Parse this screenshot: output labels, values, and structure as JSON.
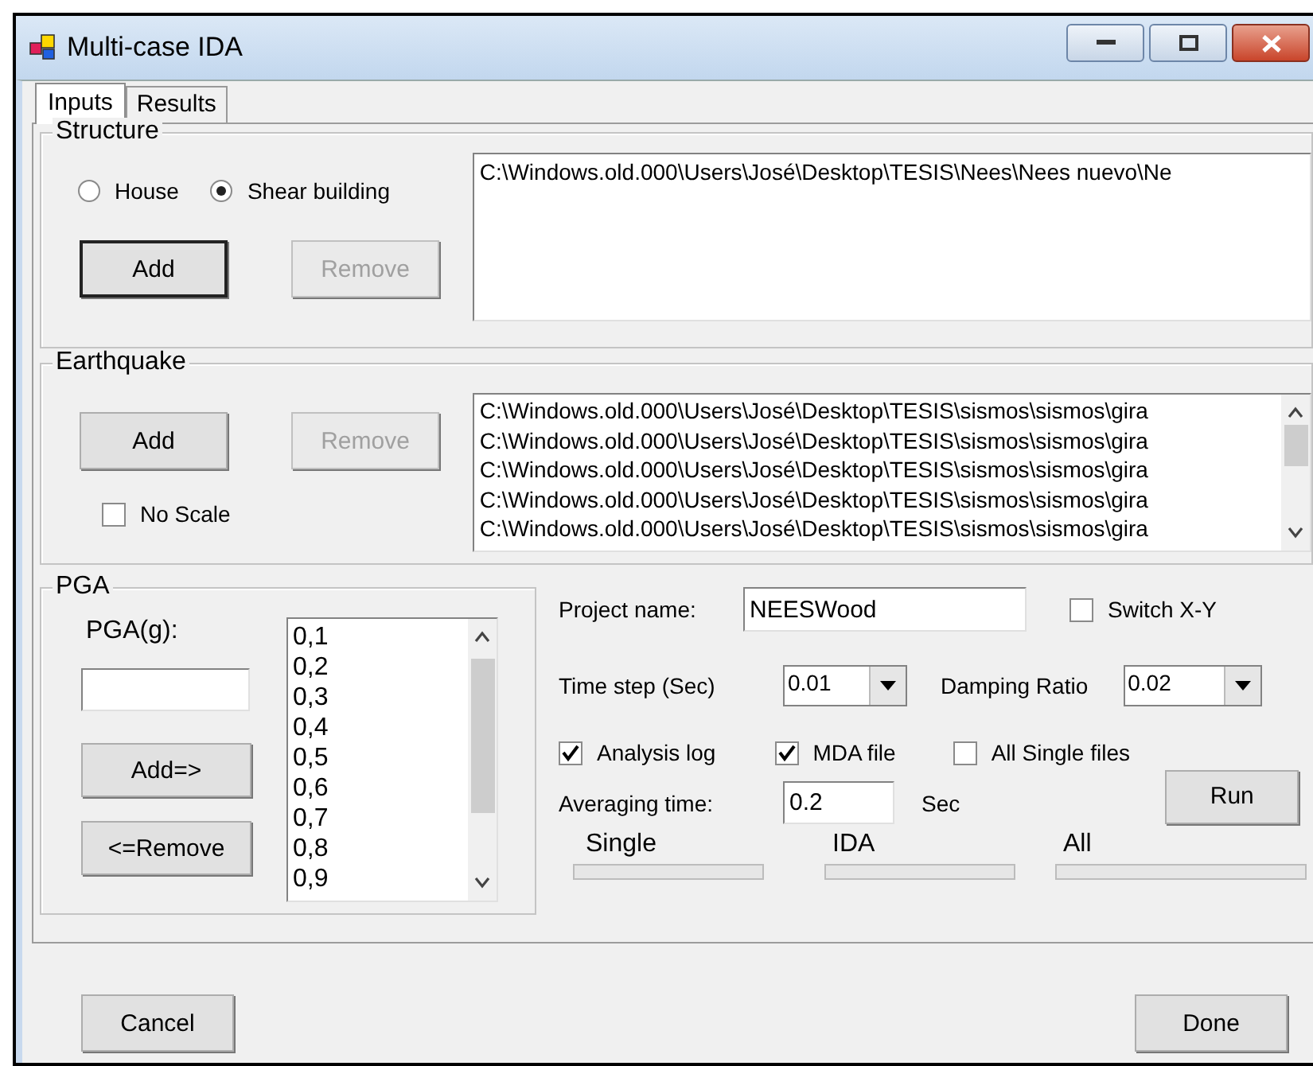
{
  "window": {
    "title": "Multi-case IDA"
  },
  "tabs": [
    {
      "label": "Inputs",
      "selected": true
    },
    {
      "label": "Results",
      "selected": false
    }
  ],
  "structure": {
    "title": "Structure",
    "options": [
      {
        "label": "House",
        "selected": false
      },
      {
        "label": "Shear building",
        "selected": true
      }
    ],
    "buttons": [
      {
        "label": "Add",
        "disabled": false,
        "focused": true
      },
      {
        "label": "Remove",
        "disabled": true,
        "focused": false
      }
    ],
    "files": [
      "C:\\Windows.old.000\\Users\\José\\Desktop\\TESIS\\Nees\\Nees nuevo\\Ne"
    ]
  },
  "earthquake": {
    "title": "Earthquake",
    "buttons": [
      {
        "label": "Add",
        "disabled": false,
        "focused": false
      },
      {
        "label": "Remove",
        "disabled": true,
        "focused": false
      }
    ],
    "no_scale": {
      "label": "No Scale",
      "checked": false
    },
    "files": [
      "C:\\Windows.old.000\\Users\\José\\Desktop\\TESIS\\sismos\\sismos\\gira",
      "C:\\Windows.old.000\\Users\\José\\Desktop\\TESIS\\sismos\\sismos\\gira",
      "C:\\Windows.old.000\\Users\\José\\Desktop\\TESIS\\sismos\\sismos\\gira",
      "C:\\Windows.old.000\\Users\\José\\Desktop\\TESIS\\sismos\\sismos\\gira",
      "C:\\Windows.old.000\\Users\\José\\Desktop\\TESIS\\sismos\\sismos\\gira"
    ]
  },
  "pga": {
    "title": "PGA",
    "field_label": "PGA(g):",
    "buttons": [
      {
        "label": "Add=>",
        "disabled": false,
        "focused": false
      },
      {
        "label": "<=Remove",
        "disabled": false,
        "focused": false
      }
    ],
    "values": [
      "0,1",
      "0,2",
      "0,3",
      "0,4",
      "0,5",
      "0,6",
      "0,7",
      "0,8",
      "0,9"
    ]
  },
  "settings": {
    "project_name": {
      "label": "Project name:",
      "value": "NEESWood"
    },
    "switch_xy": {
      "label": "Switch X-Y",
      "checked": false
    },
    "time_step": {
      "label": "Time step (Sec)",
      "value": "0.01"
    },
    "damping": {
      "label": "Damping Ratio",
      "value": "0.02"
    },
    "outputs": [
      {
        "label": "Analysis log",
        "checked": true
      },
      {
        "label": "MDA file",
        "checked": true
      },
      {
        "label": "All Single files",
        "checked": false
      }
    ],
    "averaging": {
      "label": "Averaging time:",
      "value": "0.2",
      "unit": "Sec"
    },
    "run": {
      "label": "Run",
      "disabled": false,
      "focused": false
    },
    "progress": [
      {
        "label": "Single",
        "level": 0
      },
      {
        "label": "IDA",
        "level": 0
      },
      {
        "label": "All",
        "level": 0
      }
    ]
  },
  "footer": {
    "buttons": [
      {
        "label": "Cancel",
        "disabled": false,
        "focused": false
      },
      {
        "label": "Done",
        "disabled": false,
        "focused": false
      }
    ]
  }
}
